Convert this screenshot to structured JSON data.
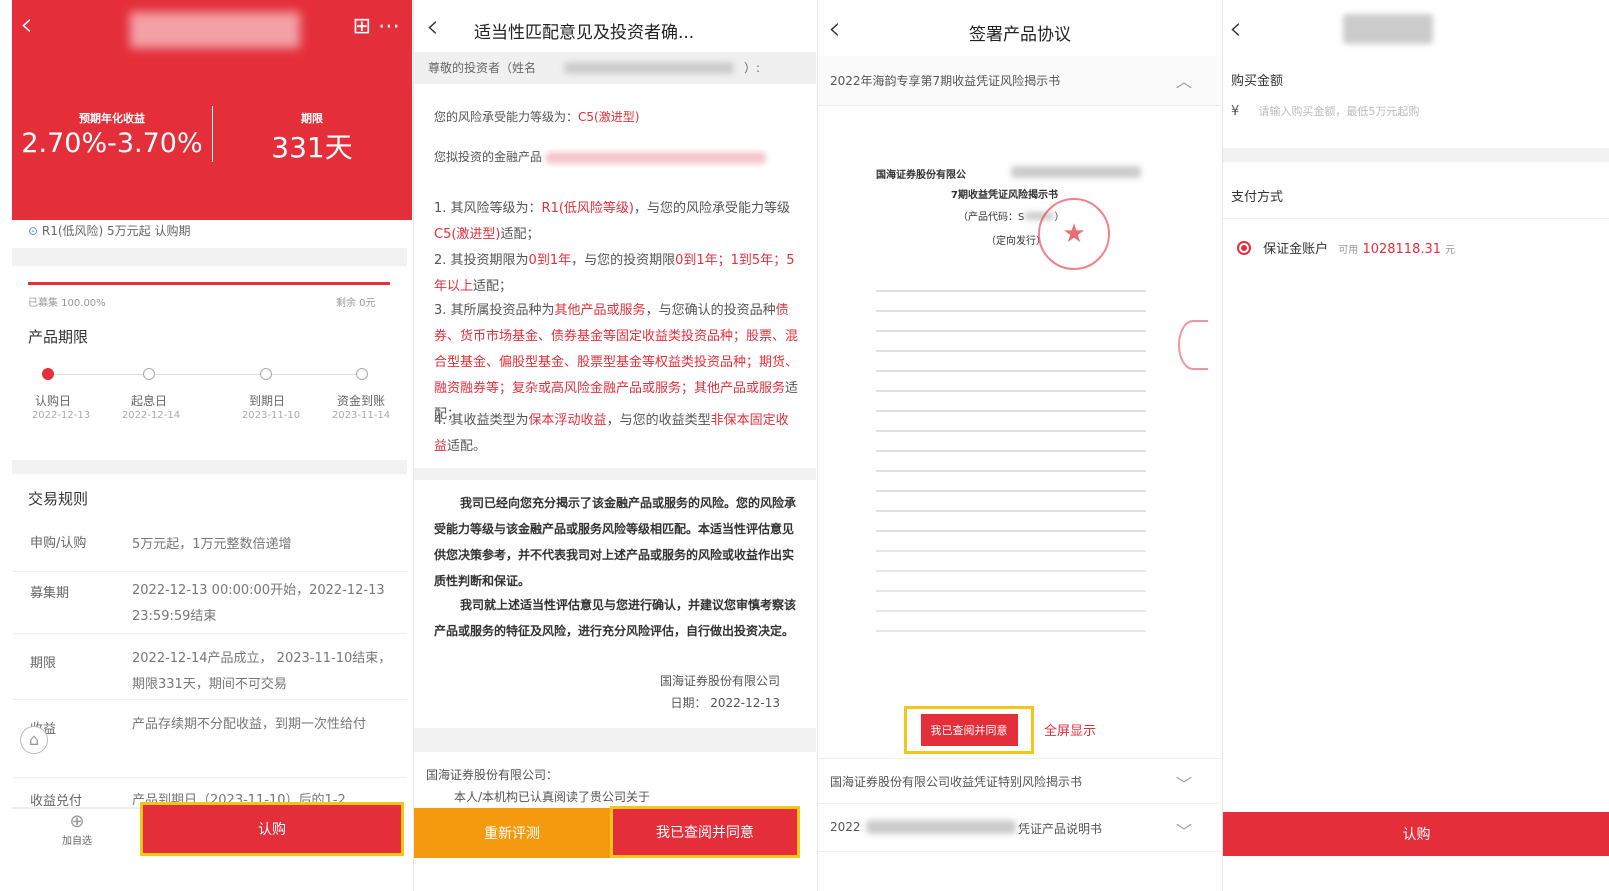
{
  "panel1": {
    "yield_label": "预期年化收益",
    "yield_value": "2.70%-3.70%",
    "period_label": "期限",
    "period_value": "331天",
    "risk_tag": "R1(低风险)  5万元起  认购期",
    "raised": "已募集 100.00%",
    "remaining": "剩余 0元",
    "term_title": "产品期限",
    "timeline": [
      {
        "label": "认购日",
        "date": "2022-12-13"
      },
      {
        "label": "起息日",
        "date": "2022-12-14"
      },
      {
        "label": "到期日",
        "date": "2023-11-10"
      },
      {
        "label": "资金到账",
        "date": "2023-11-14"
      }
    ],
    "rules_title": "交易规则",
    "rules": [
      {
        "key": "申购/认购",
        "value": "5万元起，1万元整数倍递增"
      },
      {
        "key": "募集期",
        "value": "2022-12-13 00:00:00开始，2022-12-13 23:59:59结束"
      },
      {
        "key": "期限",
        "value": "2022-12-14产品成立， 2023-11-10结束，期限331天，期间不可交易"
      },
      {
        "key": "收益",
        "value": "产品存续期不分配收益，到期一次性给付"
      },
      {
        "key": "收益兑付",
        "value": "产品到期日（2023-11-10）后的1-2"
      }
    ],
    "add_watch": "加自选",
    "subscribe_btn": "认购"
  },
  "panel2": {
    "title": "适当性匹配意见及投资者确...",
    "greeting": "尊敬的投资者（姓名",
    "greeting_end": "）:",
    "risk_level_prefix": "您的风险承受能力等级为：",
    "risk_level": "C5(激进型)",
    "product_prefix": "您拟投资的金融产品",
    "item1_a": "1. 其风险等级为：",
    "item1_b": "R1(低风险等级)",
    "item1_c": "，与您的风险承受能力等级",
    "item1_d": "C5(激进型)",
    "item1_e": "适配；",
    "item2_a": "2. 其投资期限为",
    "item2_b": "0到1年",
    "item2_c": "，与您的投资期限",
    "item2_d": "0到1年；1到5年；5年以上",
    "item2_e": "适配；",
    "item3_a": "3. 其所属投资品种为",
    "item3_b": "其他产品或服务",
    "item3_c": "，与您确认的投资品种",
    "item3_d": "债券、货币市场基金、债券基金等固定收益类投资品种；股票、混合型基金、偏股型基金、股票型基金等权益类投资品种；期货、融资融券等；复杂或高风险金融产品或服务；其他产品或服务",
    "item3_e": "适配；",
    "item4_a": "4. 其收益类型为",
    "item4_b": "保本浮动收益",
    "item4_c": "，与您的收益类型",
    "item4_d": "非保本固定收益",
    "item4_e": "适配。",
    "para1": "我司已经向您充分揭示了该金融产品或服务的风险。您的风险承受能力等级与该金融产品或服务风险等级相匹配。本适当性评估意见供您决策参考，并不代表我司对上述产品或服务的风险或收益作出实质性判断和保证。",
    "para2": "我司就上述适当性评估意见与您进行确认，并建议您审慎考察该产品或服务的特征及风险，进行充分风险评估，自行做出投资决定。",
    "company": "国海证券股份有限公司",
    "date": "日期： 2022-12-13",
    "to_company": "国海证券股份有限公司：",
    "statement": "本人/本机构已认真阅读了贵公司关于",
    "reassess_btn": "重新评测",
    "agree_btn": "我已查阅并同意"
  },
  "panel3": {
    "title": "签署产品协议",
    "doc1": "2022年海韵专享第7期收益凭证风险揭示书",
    "doc_heading1": "国海证券股份有限公",
    "doc_heading2": "7期收益凭证风险揭示书",
    "doc_code": "（产品代码：S",
    "doc_code_end": "）",
    "doc_placement": "（定向发行）",
    "agree_btn": "我已查阅并同意",
    "fullscreen": "全屏显示",
    "doc2": "国海证券股份有限公司收益凭证特别风险揭示书",
    "doc3_a": "2022",
    "doc3_b": "凭证产品说明书"
  },
  "panel4": {
    "amount_label": "购买金额",
    "currency": "¥",
    "amount_placeholder": "请输入购买金额，最低5万元起购",
    "pay_label": "支付方式",
    "account": "保证金账户",
    "available_label": "可用",
    "available_value": "1028118.31",
    "unit": "元",
    "subscribe_btn": "认购"
  },
  "colors": {
    "brand_red": "#e42f3b",
    "orange": "#f59a0f",
    "highlight": "#f5c518"
  }
}
